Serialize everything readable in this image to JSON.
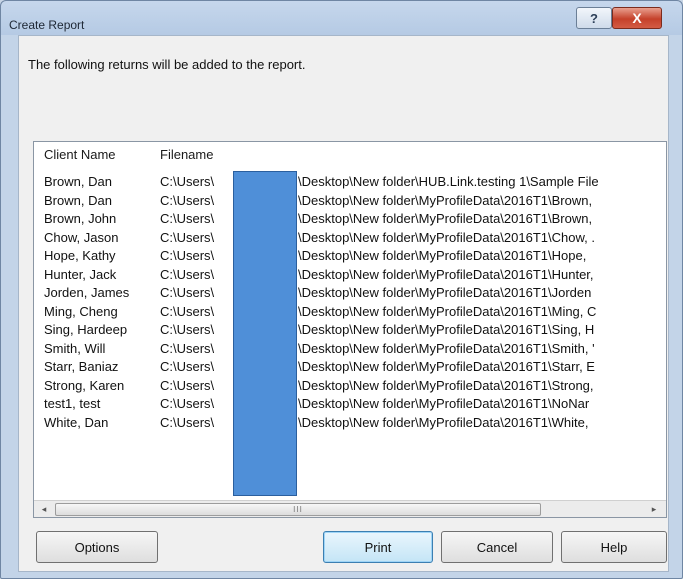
{
  "window": {
    "title": "Create Report",
    "help_label": "?",
    "close_label": "X"
  },
  "intro_text": "The following returns will be added to the report.",
  "table": {
    "columns": [
      "Client Name",
      "Filename"
    ],
    "rows": [
      {
        "name": "Brown, Dan",
        "users": "C:\\Users\\",
        "path": "\\Desktop\\New folder\\HUB.Link.testing 1\\Sample File"
      },
      {
        "name": "Brown, Dan",
        "users": "C:\\Users\\",
        "path": "\\Desktop\\New folder\\MyProfileData\\2016T1\\Brown,"
      },
      {
        "name": "Brown, John",
        "users": "C:\\Users\\",
        "path": "\\Desktop\\New folder\\MyProfileData\\2016T1\\Brown,"
      },
      {
        "name": "Chow, Jason",
        "users": "C:\\Users\\",
        "path": "\\Desktop\\New folder\\MyProfileData\\2016T1\\Chow, ."
      },
      {
        "name": "Hope, Kathy",
        "users": "C:\\Users\\",
        "path": "\\Desktop\\New folder\\MyProfileData\\2016T1\\Hope,"
      },
      {
        "name": "Hunter, Jack",
        "users": "C:\\Users\\",
        "path": "\\Desktop\\New folder\\MyProfileData\\2016T1\\Hunter,"
      },
      {
        "name": "Jorden, James",
        "users": "C:\\Users\\",
        "path": "\\Desktop\\New folder\\MyProfileData\\2016T1\\Jorden"
      },
      {
        "name": "Ming, Cheng",
        "users": "C:\\Users\\",
        "path": "\\Desktop\\New folder\\MyProfileData\\2016T1\\Ming, C"
      },
      {
        "name": "Sing, Hardeep",
        "users": "C:\\Users\\",
        "path": "\\Desktop\\New folder\\MyProfileData\\2016T1\\Sing, H"
      },
      {
        "name": "Smith, Will",
        "users": "C:\\Users\\",
        "path": "\\Desktop\\New folder\\MyProfileData\\2016T1\\Smith, '"
      },
      {
        "name": "Starr, Baniaz",
        "users": "C:\\Users\\",
        "path": "\\Desktop\\New folder\\MyProfileData\\2016T1\\Starr, E"
      },
      {
        "name": "Strong, Karen",
        "users": "C:\\Users\\",
        "path": "\\Desktop\\New folder\\MyProfileData\\2016T1\\Strong,"
      },
      {
        "name": "test1, test",
        "users": "C:\\Users\\",
        "path": "\\Desktop\\New folder\\MyProfileData\\2016T1\\NoNar"
      },
      {
        "name": "White, Dan",
        "users": "C:\\Users\\",
        "path": "\\Desktop\\New folder\\MyProfileData\\2016T1\\White,"
      }
    ]
  },
  "scrollbar": {
    "left_arrow": "◂",
    "right_arrow": "▸",
    "thumb_grip": "III"
  },
  "buttons": {
    "options": "Options",
    "print": "Print",
    "cancel": "Cancel",
    "help": "Help"
  },
  "colors": {
    "redaction": "#4f8fd8",
    "close_button": "#c5412a",
    "default_button_border": "#3c7fb1"
  }
}
